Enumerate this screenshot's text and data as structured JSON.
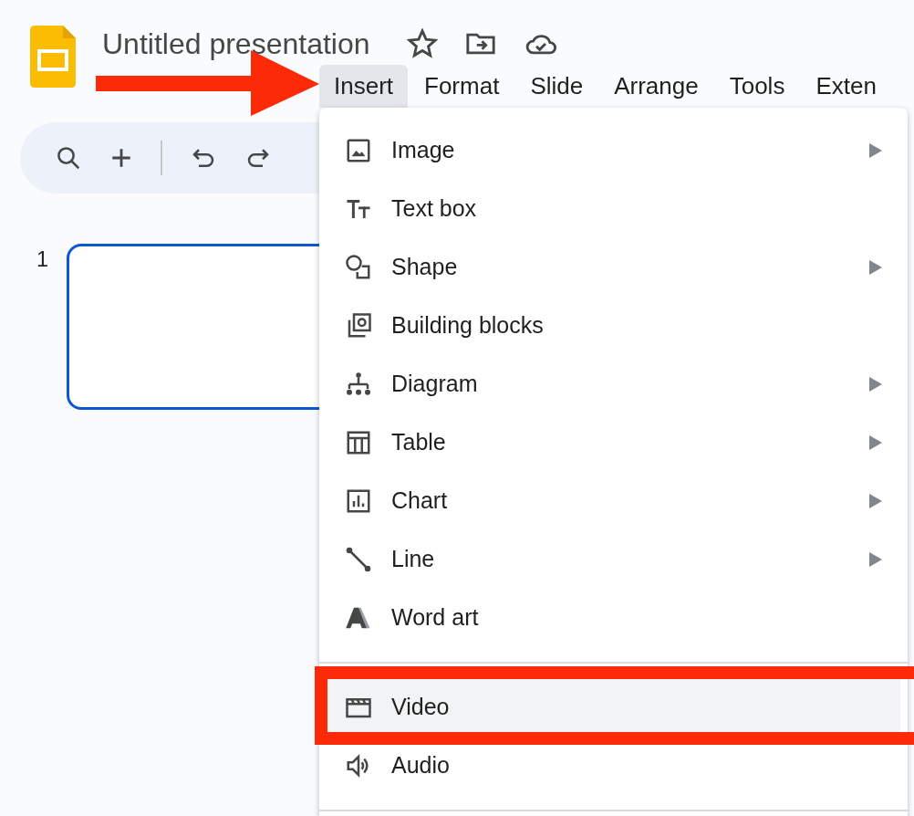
{
  "app": {
    "title": "Untitled presentation"
  },
  "menubar": [
    {
      "label": "Insert",
      "selected": true
    },
    {
      "label": "Format",
      "selected": false
    },
    {
      "label": "Slide",
      "selected": false
    },
    {
      "label": "Arrange",
      "selected": false
    },
    {
      "label": "Tools",
      "selected": false
    },
    {
      "label": "Exten",
      "selected": false
    }
  ],
  "slides": [
    {
      "number": "1",
      "selected": true
    }
  ],
  "insert_menu": {
    "groups": [
      [
        {
          "label": "Image",
          "submenu": true,
          "highlighted": false
        },
        {
          "label": "Text box",
          "submenu": false,
          "highlighted": false
        },
        {
          "label": "Shape",
          "submenu": true,
          "highlighted": false
        },
        {
          "label": "Building blocks",
          "submenu": false,
          "highlighted": false
        },
        {
          "label": "Diagram",
          "submenu": true,
          "highlighted": false
        },
        {
          "label": "Table",
          "submenu": true,
          "highlighted": false
        },
        {
          "label": "Chart",
          "submenu": true,
          "highlighted": false
        },
        {
          "label": "Line",
          "submenu": true,
          "highlighted": false
        },
        {
          "label": "Word art",
          "submenu": false,
          "highlighted": false
        }
      ],
      [
        {
          "label": "Video",
          "submenu": false,
          "highlighted": true
        },
        {
          "label": "Audio",
          "submenu": false,
          "highlighted": false
        }
      ]
    ]
  },
  "annotations": {
    "arrow": true,
    "frame": true
  }
}
